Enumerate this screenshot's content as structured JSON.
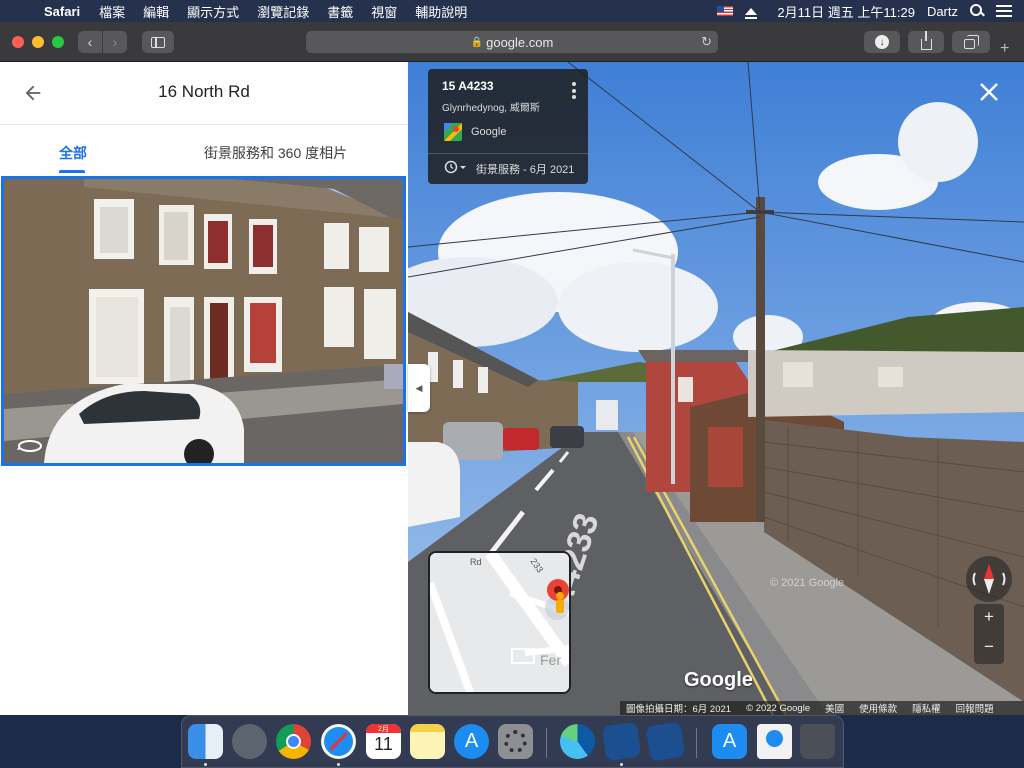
{
  "menubar": {
    "app_name": "Safari",
    "items": [
      "檔案",
      "編輯",
      "顯示方式",
      "瀏覽記錄",
      "書籤",
      "視窗",
      "輔助說明"
    ],
    "clock": "2月11日 週五 上午11:29",
    "user": "Dartz"
  },
  "browser": {
    "url": "google.com",
    "lock_glyph": "🔒"
  },
  "panel": {
    "title": "16 North Rd",
    "tabs": [
      "全部",
      "街景服務和 360 度相片"
    ],
    "active_tab": "全部"
  },
  "info_card": {
    "title": "15 A4233",
    "subtitle": "Glynrhedynog, 威爾斯",
    "source": "Google",
    "date": "街景服務 - 6月 2021"
  },
  "street_view": {
    "watermark": "© 2021 Google",
    "road_marking": "A4233",
    "logo_text": "Google",
    "zoom_in": "+",
    "zoom_out": "−"
  },
  "minimap": {
    "road_label": "233",
    "road_label_2": "Rd",
    "place_label": "Fer"
  },
  "attribution": {
    "capture_date": "圖像拍攝日期：6月 2021",
    "copyright": "© 2022 Google",
    "country": "美國",
    "terms": "使用條款",
    "privacy": "隱私權",
    "report": "回報問題"
  },
  "dock": {
    "calendar_month": "2月",
    "calendar_day": "11"
  },
  "colors": {
    "accent_blue": "#1a73e8",
    "menubar_bg": "#26324d",
    "toolbar_bg": "#3a3a3c"
  }
}
